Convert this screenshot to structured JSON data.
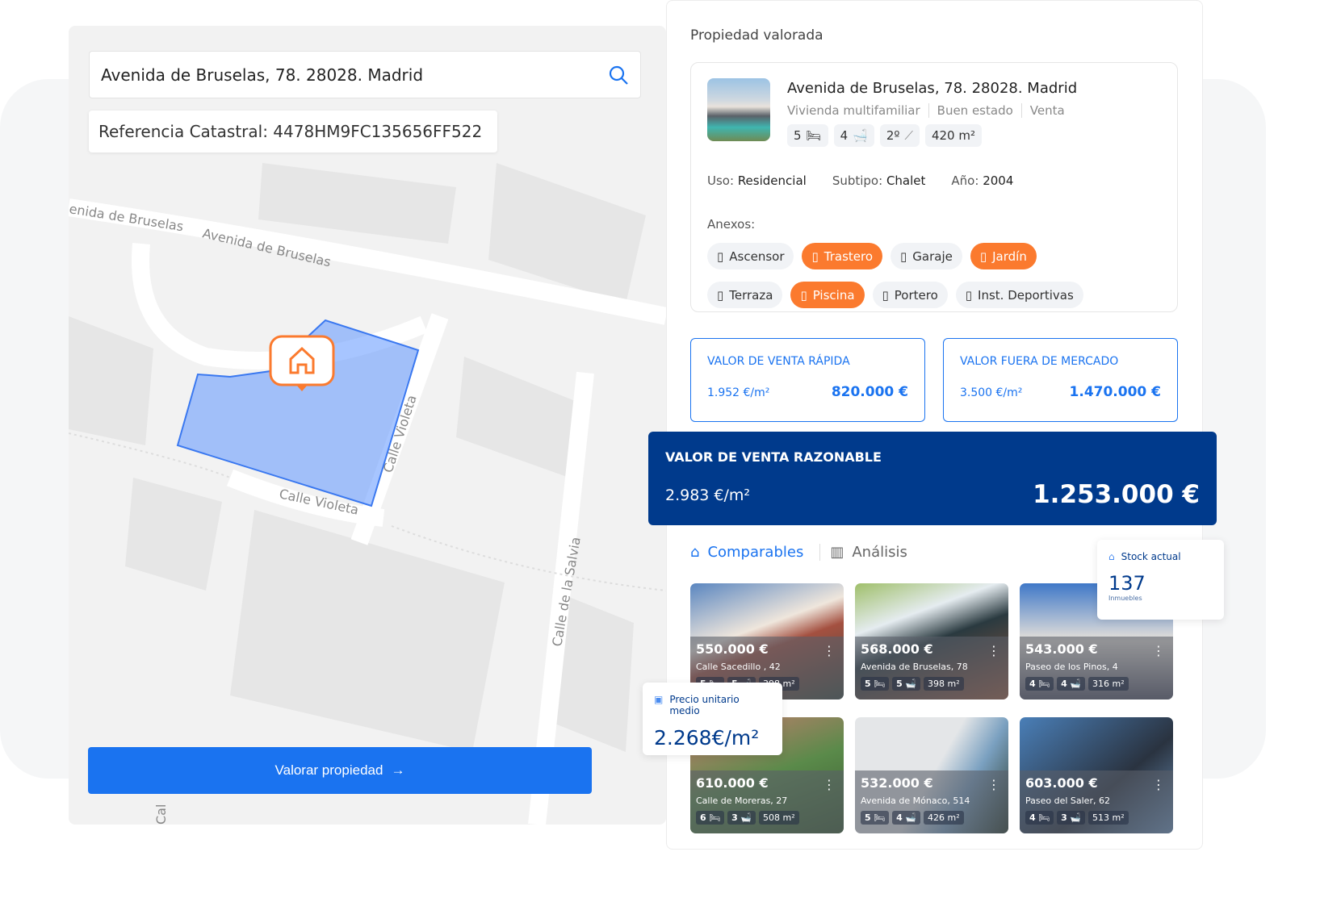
{
  "search": {
    "value": "Avenida de Bruselas, 78. 28028. Madrid",
    "icon": "search-icon"
  },
  "catastral": "Referencia Catastral: 4478HM9FC135656FF522",
  "map": {
    "streets": [
      "enida de Bruselas",
      "Avenida de Bruselas",
      "Calle Violeta",
      "Calle Violeta",
      "Calle de la Salvia",
      "Cal"
    ]
  },
  "valorar_button": "Valorar propiedad",
  "panel": {
    "title": "Propiedad valorada",
    "address": "Avenida de Bruselas, 78. 28028. Madrid",
    "meta": [
      "Vivienda multifamiliar",
      "Buen estado",
      "Venta"
    ],
    "chips": [
      "5",
      "4",
      "2º",
      "420 m²"
    ],
    "uso_label": "Uso:",
    "uso": "Residencial",
    "subtipo_label": "Subtipo:",
    "subtipo": "Chalet",
    "ano_label": "Año:",
    "ano": "2004",
    "anexos_label": "Anexos:",
    "anexos": [
      {
        "label": "Ascensor",
        "active": false
      },
      {
        "label": "Trastero",
        "active": true
      },
      {
        "label": "Garaje",
        "active": false
      },
      {
        "label": "Jardín",
        "active": true
      },
      {
        "label": "Terraza",
        "active": false
      },
      {
        "label": "Piscina",
        "active": true
      },
      {
        "label": "Portero",
        "active": false
      },
      {
        "label": "Inst. Deportivas",
        "active": false
      }
    ]
  },
  "rapida": {
    "title": "VALOR DE VENTA RÁPIDA",
    "m2": "1.952 €/m²",
    "value": "820.000 €"
  },
  "fuera": {
    "title": "VALOR FUERA DE MERCADO",
    "m2": "3.500 €/m²",
    "value": "1.470.000 €"
  },
  "razonable": {
    "title": "VALOR DE VENTA RAZONABLE",
    "m2": "2.983 €/m²",
    "value": "1.253.000 €"
  },
  "tabs": [
    {
      "label": "Comparables"
    },
    {
      "label": "Análisis"
    }
  ],
  "comparables": [
    {
      "price": "550.000 €",
      "address": "Calle Sacedillo , 42",
      "beds": "5",
      "baths": "5",
      "area": "398 m²"
    },
    {
      "price": "568.000 €",
      "address": "Avenida de Bruselas, 78",
      "beds": "5",
      "baths": "5",
      "area": "398 m²"
    },
    {
      "price": "543.000 €",
      "address": "Paseo de los Pinos, 4",
      "beds": "4",
      "baths": "4",
      "area": "316 m²"
    },
    {
      "price": "610.000 €",
      "address": "Calle de Moreras, 27",
      "beds": "6",
      "baths": "3",
      "area": "508 m²"
    },
    {
      "price": "532.000 €",
      "address": "Avenida de Mónaco, 514",
      "beds": "5",
      "baths": "4",
      "area": "426 m²"
    },
    {
      "price": "603.000 €",
      "address": "Paseo del Saler, 62",
      "beds": "4",
      "baths": "3",
      "area": "513 m²"
    }
  ],
  "stock": {
    "label": "Stock actual",
    "value": "137",
    "unit": "Inmuebles"
  },
  "precio_medio": {
    "label": "Precio unitario medio",
    "value": "2.268€/m²"
  },
  "colors": {
    "primary": "#1a73f0",
    "navy": "#003a8c",
    "orange": "#fb7a2e"
  }
}
